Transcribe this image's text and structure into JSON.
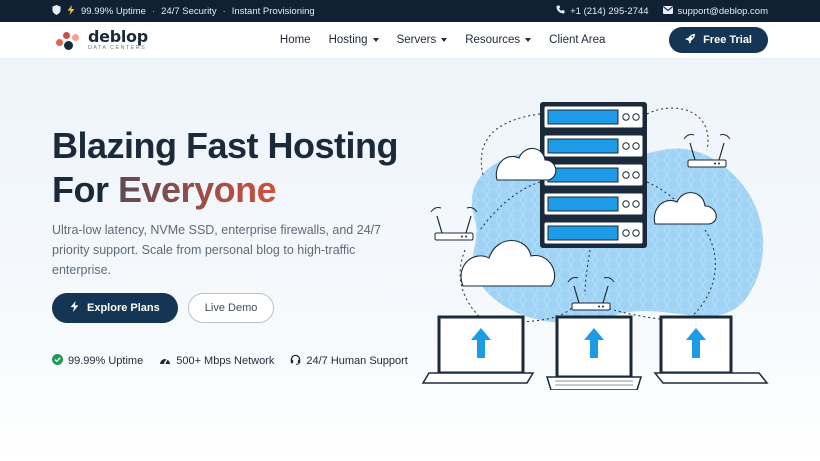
{
  "topbar": {
    "shield_icon": "shield-icon",
    "bolt_icon": "bolt-icon",
    "uptime": "99.99% Uptime",
    "security": "24/7 Security",
    "provisioning": "Instant Provisioning",
    "separator": "·",
    "phone_icon": "phone-icon",
    "phone": "+1 (214) 295-2744",
    "mail_icon": "mail-icon",
    "email": "support@deblop.com"
  },
  "nav": {
    "logo_name": "deblop",
    "logo_sub": "DATA CENTERS",
    "items": [
      {
        "label": "Home",
        "has_dropdown": false
      },
      {
        "label": "Hosting",
        "has_dropdown": true
      },
      {
        "label": "Servers",
        "has_dropdown": true
      },
      {
        "label": "Resources",
        "has_dropdown": true
      },
      {
        "label": "Client Area",
        "has_dropdown": false
      }
    ],
    "cta_label": "Free Trial",
    "cta_icon": "rocket-icon"
  },
  "hero": {
    "title_line1": "Blazing Fast Hosting",
    "title_line2_plain": "For ",
    "title_line2_accent": "Everyone",
    "lead": "Ultra-low latency, NVMe SSD, enterprise firewalls, and 24/7 priority support. Scale from personal blog to high-traffic enterprise.",
    "primary_label": "Explore Plans",
    "primary_icon": "bolt-icon",
    "secondary_label": "Live Demo",
    "features": [
      {
        "icon": "check-circle-icon",
        "label": "99.99% Uptime"
      },
      {
        "icon": "gauge-icon",
        "label": "500+ Mbps Network"
      },
      {
        "icon": "headset-icon",
        "label": "24/7 Human Support"
      }
    ]
  },
  "colors": {
    "dark_navy": "#0f2133",
    "button_navy": "#143553",
    "accent_gradient_start": "#5e4a52",
    "accent_gradient_end": "#d0513e",
    "illustration_blue": "#9fd3f5",
    "server_blue": "#1e9be6",
    "check_green": "#1f9d55"
  }
}
